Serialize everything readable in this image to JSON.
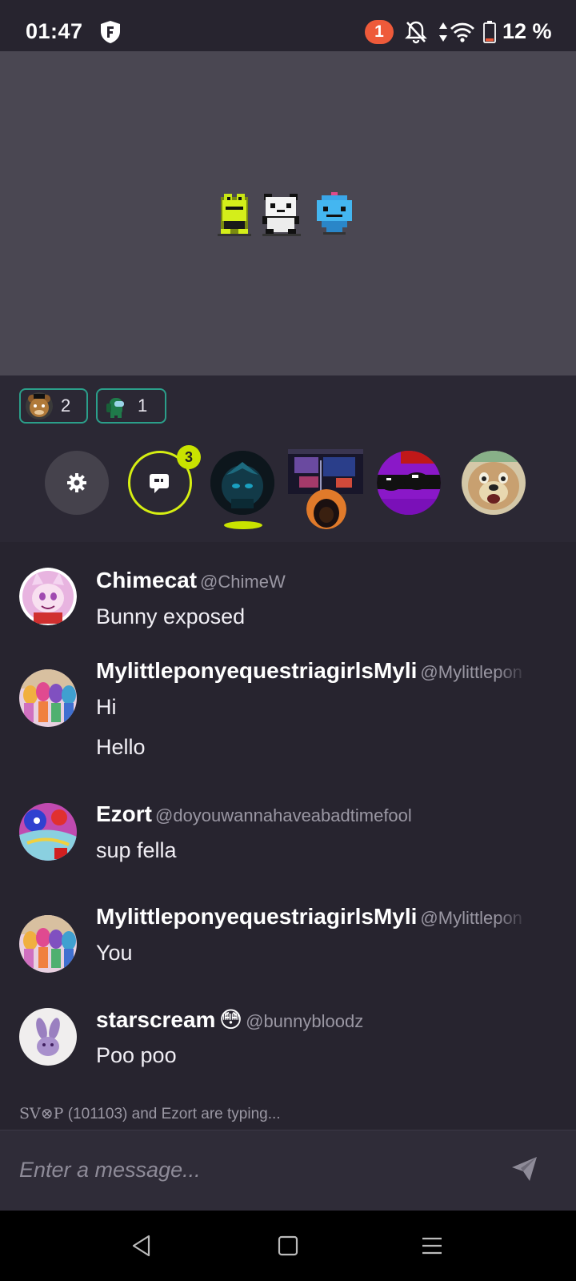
{
  "status_bar": {
    "time": "01:47",
    "notification_count": "1",
    "battery": "12 %",
    "battery_level": 0.12,
    "icons": [
      "shield-icon",
      "bell-off-icon",
      "data-arrows-icon",
      "wifi-icon",
      "battery-icon"
    ]
  },
  "room": {
    "reactions": [
      {
        "avatar": "bear-avatar",
        "count": "2"
      },
      {
        "avatar": "crewmate-avatar",
        "count": "1"
      }
    ],
    "chat_badge": "3",
    "participants": [
      "dark-avatar",
      "streamer-avatar",
      "purple-avatar",
      "dog-avatar"
    ]
  },
  "messages": [
    {
      "name": "Chimecat",
      "handle": "@ChimeW",
      "lines": [
        "Bunny exposed"
      ]
    },
    {
      "name": "MylittleponyequestriagirlsMyli",
      "handle": "@Mylittlepon",
      "lines": [
        "Hi",
        "Hello"
      ]
    },
    {
      "name": "Ezort",
      "handle": "@doyouwannahaveabadtimefool",
      "lines": [
        "sup fella"
      ]
    },
    {
      "name": "MylittleponyequestriagirlsMyli",
      "handle": "@Mylittlepon",
      "lines": [
        "You"
      ]
    },
    {
      "name": "starscream",
      "emoji": "😳",
      "handle": "@bunnybloodz",
      "lines": [
        "Poo poo"
      ]
    }
  ],
  "typing": {
    "prefix": "SV⊗P",
    "rest": " (101103) and Ezort are typing..."
  },
  "composer": {
    "placeholder": "Enter a message..."
  },
  "colors": {
    "accent": "#c9e300",
    "chip_border": "#2b9f8a",
    "notification": "#ee5a3a",
    "background": "#27242f",
    "stage": "#4a4752"
  }
}
